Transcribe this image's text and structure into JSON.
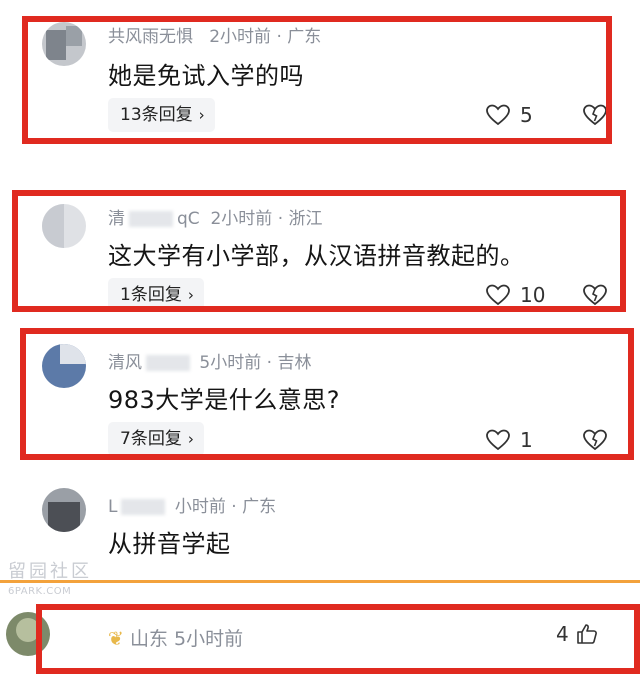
{
  "comments": [
    {
      "meta_name": "共风雨无惧",
      "meta_time": "2小时前",
      "meta_location": "广东",
      "text": "她是免试入学的吗",
      "replies": "13条回复",
      "likes": "5"
    },
    {
      "meta_name": "清",
      "meta_name_tail": "qC",
      "meta_time": "2小时前",
      "meta_location": "浙江",
      "text": "这大学有小学部，从汉语拼音教起的。",
      "replies": "1条回复",
      "likes": "10"
    },
    {
      "meta_name": "清风",
      "meta_time": "5小时前",
      "meta_location": "吉林",
      "text": "983大学是什么意思?",
      "replies": "7条回复",
      "likes": "1"
    },
    {
      "meta_name": "L",
      "meta_time": "小时前",
      "meta_location": "广东",
      "text": "从拼音学起"
    }
  ],
  "bottom": {
    "meta_location": "山东",
    "meta_time": "5小时前",
    "likes": "4"
  },
  "watermark": {
    "title": "留园社区",
    "sub": "6PARK.COM"
  },
  "colors": {
    "highlight_box": "#e02a20",
    "divider_orange": "#f3a23c"
  },
  "icons": [
    "heart-icon",
    "broken-heart-icon",
    "chevron-right-icon",
    "thumbs-up-icon"
  ]
}
